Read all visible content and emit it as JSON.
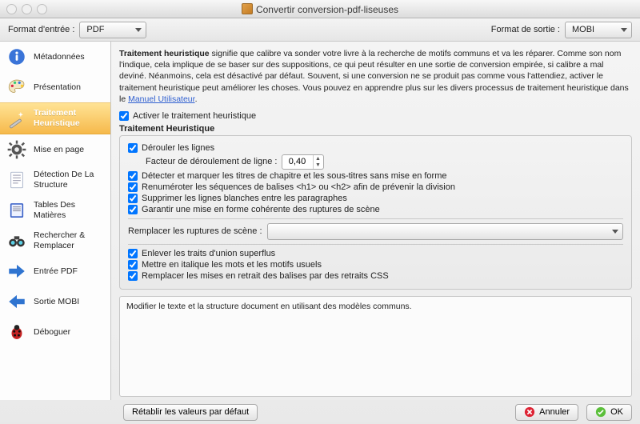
{
  "window": {
    "title": "Convertir conversion-pdf-liseuses"
  },
  "toolbar": {
    "input_label": "Format d'entrée :",
    "input_value": "PDF",
    "output_label": "Format de sortie :",
    "output_value": "MOBI"
  },
  "sidebar": {
    "items": [
      {
        "label": "Métadonnées",
        "icon": "info"
      },
      {
        "label": "Présentation",
        "icon": "palette"
      },
      {
        "label": "Traitement Heuristique",
        "icon": "wand",
        "selected": true
      },
      {
        "label": "Mise en page",
        "icon": "gear"
      },
      {
        "label": "Détection De La Structure",
        "icon": "doc"
      },
      {
        "label": "Tables Des Matières",
        "icon": "book"
      },
      {
        "label": "Rechercher & Remplacer",
        "icon": "binoc"
      },
      {
        "label": "Entrée PDF",
        "icon": "arrow-right"
      },
      {
        "label": "Sortie MOBI",
        "icon": "arrow-left"
      },
      {
        "label": "Déboguer",
        "icon": "bug"
      }
    ]
  },
  "main": {
    "intro_bold": "Traitement heuristique",
    "intro_rest": " signifie que calibre va sonder votre livre à la recherche de motifs communs et va les réparer. Comme son nom l'indique, cela implique de se baser sur des suppositions, ce qui peut résulter en une sortie de conversion empirée, si calibre a mal deviné. Néanmoins, cela est désactivé par défaut. Souvent, si une conversion ne se produit pas comme vous l'attendiez, activer le traitement heuristique peut améliorer les choses. Vous pouvez en apprendre plus sur les divers processus de traitement heuristique dans le ",
    "intro_link": "Manuel Utilisateur",
    "intro_punct": ".",
    "enable_label": "Activer le traitement heuristique",
    "section_title": "Traitement Heuristique",
    "opts": {
      "unwrap": "Dérouler les lignes",
      "factor_label": "Facteur de déroulement de ligne :",
      "factor_value": "0,40",
      "detect": "Détecter et marquer les titres de chapitre et les sous-titres sans mise en forme",
      "renumber": "Renuméroter les séquences de balises <h1> ou <h2> afin de prévenir la division",
      "blank": "Supprimer les lignes blanches entre les paragraphes",
      "scene": "Garantir une mise en forme cohérente des ruptures de scène",
      "replace_label": "Remplacer les ruptures de scène :",
      "replace_value": "",
      "hyphen": "Enlever les traits d'union superflus",
      "italic": "Mettre en italique les mots et les motifs usuels",
      "css": "Remplacer les mises en retrait des balises par des retraits CSS"
    },
    "info_text": "Modifier le texte et la structure document en utilisant des modèles communs."
  },
  "footer": {
    "reset": "Rétablir les valeurs par défaut",
    "cancel": "Annuler",
    "ok": "OK"
  }
}
